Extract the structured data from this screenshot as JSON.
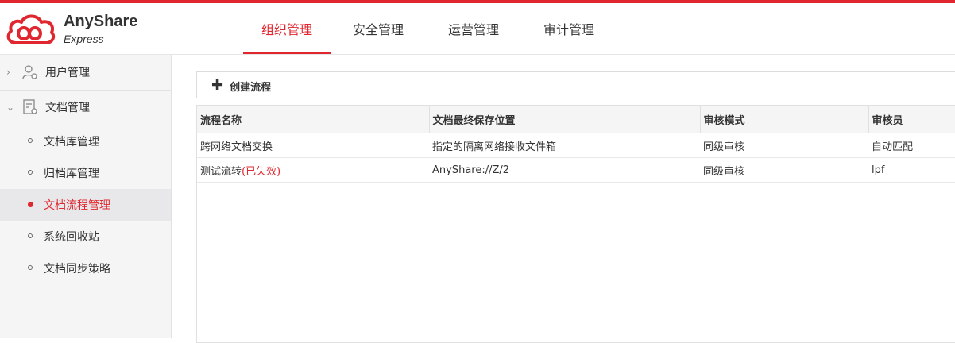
{
  "brand": {
    "title": "AnyShare",
    "subtitle": "Express",
    "accent": "#e0262e"
  },
  "nav": {
    "tabs": [
      "组织管理",
      "安全管理",
      "运营管理",
      "审计管理"
    ],
    "active_index": 0
  },
  "sidebar": {
    "groups": [
      {
        "label": "用户管理",
        "icon": "user-settings-icon",
        "expanded": false
      },
      {
        "label": "文档管理",
        "icon": "document-settings-icon",
        "expanded": true
      }
    ],
    "items": [
      "文档库管理",
      "归档库管理",
      "文档流程管理",
      "系统回收站",
      "文档同步策略"
    ],
    "active_index": 2
  },
  "toolbar": {
    "create_label": "创建流程",
    "create_icon": "plus-icon"
  },
  "table": {
    "columns": [
      "流程名称",
      "文档最终保存位置",
      "审核模式",
      "审核员"
    ],
    "rows": [
      {
        "name": "跨网络文档交换",
        "status": "",
        "location": "指定的隔离网络接收文件箱",
        "mode": "同级审核",
        "auditor": "自动匹配"
      },
      {
        "name": "测试流转",
        "status": "(已失效)",
        "location": "AnyShare://Z/2",
        "mode": "同级审核",
        "auditor": "lpf"
      }
    ]
  }
}
